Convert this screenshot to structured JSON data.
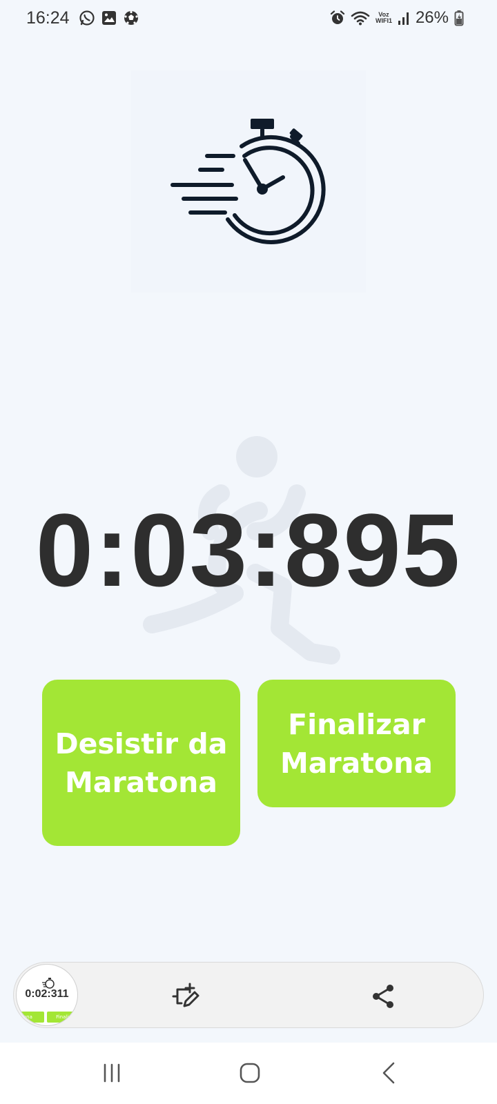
{
  "status_bar": {
    "time": "16:24",
    "left_icons": [
      "whatsapp-icon",
      "gallery-icon",
      "soccer-ball-icon"
    ],
    "right_icons": [
      "alarm-icon",
      "wifi-icon",
      "voz-wifi-icon",
      "signal-icon",
      "battery-icon"
    ],
    "voz_line1": "Voz",
    "voz_line2": "WIFI1",
    "battery": "26%"
  },
  "hero": {
    "icon": "stopwatch-icon"
  },
  "timer": {
    "value": "0:03:895"
  },
  "buttons": {
    "give_up": "Desistir da Maratona",
    "finish": "Finalizar Maratona",
    "color": "#a3e635"
  },
  "floating_bar": {
    "thumbnail_time": "0:02:311",
    "thumbnail_btn_left": "tona",
    "thumbnail_btn_right": "Finaliz",
    "edit_icon": "crop-edit-icon",
    "share_icon": "share-icon"
  },
  "nav": {
    "recent_icon": "recent-apps-icon",
    "home_icon": "home-icon",
    "back_icon": "back-icon"
  },
  "colors": {
    "background": "#f3f7fc",
    "timer_text": "#2e2e2e",
    "accent": "#a3e635"
  }
}
